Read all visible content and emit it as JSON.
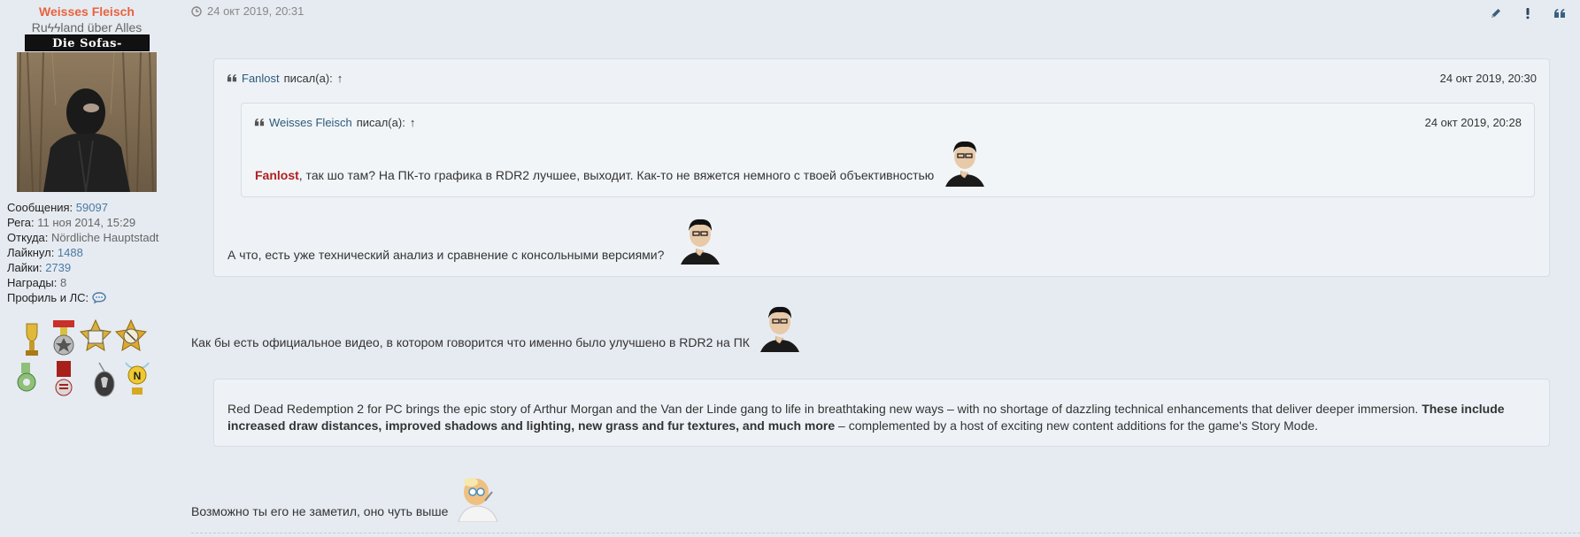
{
  "user": {
    "name": "Weisses Fleisch",
    "title": "Ruϟϟland über Alles",
    "banner": "Die Sofas-Division",
    "stats": [
      {
        "label": "Сообщения: ",
        "value": "59097"
      },
      {
        "label": "Рега: ",
        "value": "11 ноя 2014, 15:29"
      },
      {
        "label": "Откуда: ",
        "value": "Nördliche Hauptstadt"
      },
      {
        "label": "Лайкнул: ",
        "value": "1488"
      },
      {
        "label": "Лайки: ",
        "value": "2739"
      },
      {
        "label": "Награды: ",
        "value": "8"
      },
      {
        "label": "Профиль и ЛС: ",
        "value": ""
      }
    ]
  },
  "post": {
    "date": "24 окт 2019, 20:31",
    "actions": [
      "pencil-icon",
      "exclamation-icon",
      "quote-icon"
    ],
    "outer_quote": {
      "author": "Fanlost",
      "wrote": "писал(а):",
      "arrow": "↑",
      "date": "24 окт 2019, 20:30",
      "text": "А что, есть уже технический анализ и сравнение с консольными версиями?"
    },
    "inner_quote": {
      "author": "Weisses Fleisch",
      "wrote": "писал(а):",
      "arrow": "↑",
      "date": "24 окт 2019, 20:28",
      "mention": "Fanlost",
      "text": ", так шо там? На ПК-то графика в RDR2 лучшее, выходит. Как-то не вяжется немного с твоей объективностью"
    },
    "reply_text": "Как бы есть официальное видео, в котором говорится что именно было улучшено в RDR2 на ПК",
    "excerpt": {
      "part1": "Red Dead Redemption 2 for PC brings the epic story of Arthur Morgan and the Van der Linde gang to life in breathtaking new ways – with no shortage of dazzling technical enhancements that deliver deeper immersion. ",
      "bold1": "These include",
      "bold2": "increased draw distances, improved shadows and lighting, new grass and fur textures, and much more",
      "part2": " – complemented by a host of exciting new content additions for the game's Story Mode."
    },
    "last_text": "Возможно ты его не заметил, оно чуть выше"
  }
}
